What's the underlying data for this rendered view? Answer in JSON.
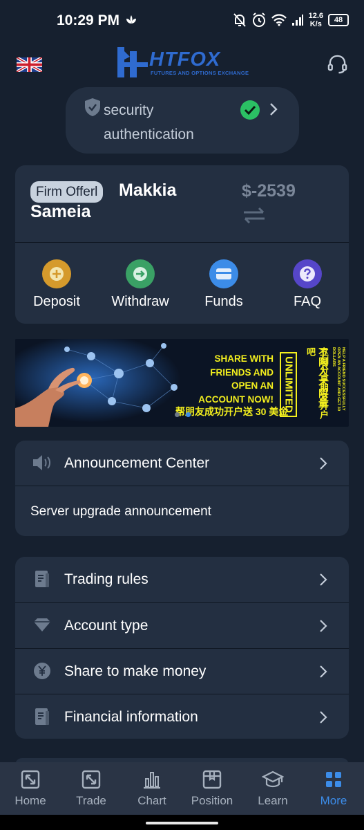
{
  "status_bar": {
    "time": "10:29 PM",
    "net_speed_value": "12.6",
    "net_speed_unit": "K/s",
    "battery": "48"
  },
  "header": {
    "logo_text": "HTFOX",
    "logo_subtitle": "FUTURES AND OPTIONS EXCHANGE",
    "language_icon": "uk-flag-icon",
    "support_icon": "headset-icon"
  },
  "security": {
    "label_line1": "security",
    "label_line2": "authentication",
    "status_icon": "check-circle-icon"
  },
  "account": {
    "badge": "Firm Offerl",
    "name": "Makkia Sameia",
    "balance": "$-2539"
  },
  "actions": [
    {
      "label": "Deposit",
      "icon": "plus-icon",
      "color": "#d59a2c"
    },
    {
      "label": "Withdraw",
      "icon": "arrow-right-icon",
      "color": "#3aa165"
    },
    {
      "label": "Funds",
      "icon": "card-icon",
      "color": "#3c8ce8"
    },
    {
      "label": "FAQ",
      "icon": "question-icon",
      "color": "#5646c9"
    }
  ],
  "banner": {
    "line1": "SHARE WITH",
    "line2": "FRIENDS AND",
    "line3": "OPEN AN",
    "line4": "ACCOUNT NOW!",
    "cn_line": "帮朋友成功开户送 30 美金",
    "unlimited": "UNLIMITED",
    "cn_vertical1": "立刻分享朋友开户吧",
    "cn_vertical2": "不限人 不限量",
    "en_vertical": "HELP A FRIEND SUCCESSFULLY OPEN AN ACCOUNT AND GET 30 DOLLARS"
  },
  "announcement": {
    "title": "Announcement Center",
    "subtitle": "Server upgrade announcement"
  },
  "menu": [
    {
      "label": "Trading rules",
      "icon": "document-icon"
    },
    {
      "label": "Account type",
      "icon": "diamond-icon"
    },
    {
      "label": "Share to make money",
      "icon": "yen-icon"
    },
    {
      "label": "Financial information",
      "icon": "document-icon"
    }
  ],
  "tabs": [
    {
      "label": "Home",
      "icon": "home-icon"
    },
    {
      "label": "Trade",
      "icon": "trade-icon"
    },
    {
      "label": "Chart",
      "icon": "chart-icon"
    },
    {
      "label": "Position",
      "icon": "position-icon"
    },
    {
      "label": "Learn",
      "icon": "learn-icon"
    },
    {
      "label": "More",
      "icon": "more-icon",
      "active": true
    }
  ],
  "colors": {
    "background": "#16202f",
    "card": "#232f41",
    "accent": "#3c8ce8",
    "brand": "#2f6bd0",
    "success": "#2bc064",
    "banner_text": "#f3ef1e"
  }
}
